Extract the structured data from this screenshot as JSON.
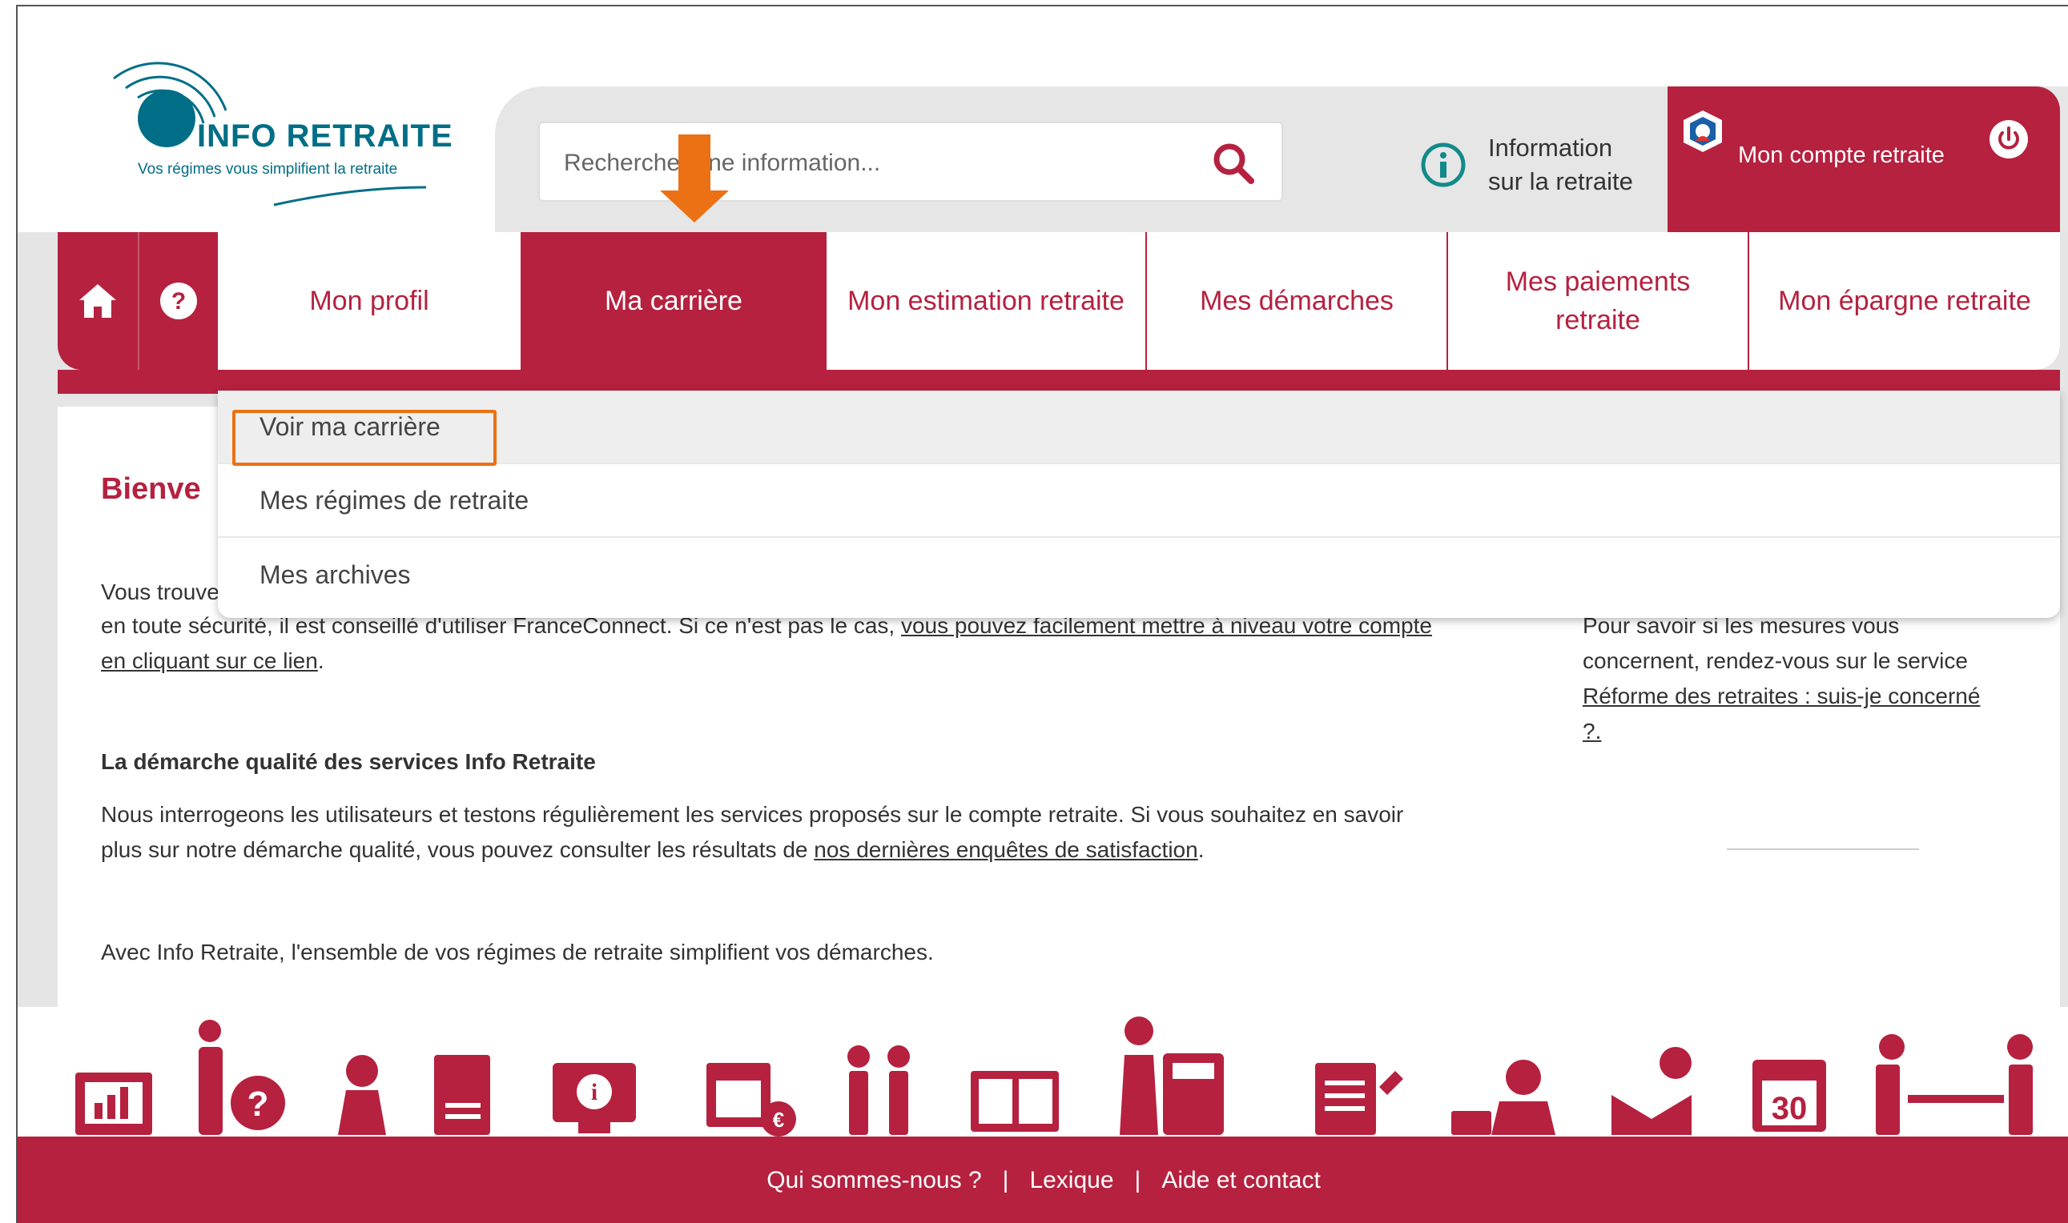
{
  "logo": {
    "title": "INFO RETRAITE",
    "subtitle": "Vos régimes vous simplifient la retraite"
  },
  "search": {
    "placeholder": "Rechercher une information..."
  },
  "info_link": {
    "line1": "Information",
    "line2": "sur la retraite"
  },
  "account": {
    "label": "Mon compte retraite"
  },
  "nav": {
    "tabs": [
      {
        "label": "Mon profil"
      },
      {
        "label": "Ma carrière",
        "active": true
      },
      {
        "label": "Mon estimation retraite"
      },
      {
        "label": "Mes démarches"
      },
      {
        "label": "Mes paiements retraite"
      },
      {
        "label": "Mon épargne retraite"
      }
    ]
  },
  "dropdown": {
    "items": [
      {
        "label": "Voir ma carrière"
      },
      {
        "label": "Mes régimes de retraite"
      },
      {
        "label": "Mes archives"
      }
    ]
  },
  "content": {
    "welcome": "Bienve",
    "p1_start": "Vous trouve",
    "p1_line2": "en toute sécurité, il est conseillé d'utiliser FranceConnect. Si ce n'est pas le cas, ",
    "p1_link_a": "vous pouvez facilement mettre à niveau votre compte",
    "p1_link_b": "en cliquant sur ce lien",
    "p1_end": ".",
    "quality_title": "La démarche qualité des services Info Retraite",
    "quality_line1": "Nous interrogeons les utilisateurs et testons régulièrement les services proposés sur le compte retraite. Si vous souhaitez en savoir",
    "quality_line2": "plus sur notre démarche qualité, vous pouvez consulter les résultats de ",
    "quality_link": "nos dernières enquêtes de satisfaction",
    "quality_end": ".",
    "closing": "Avec Info Retraite, l'ensemble de vos régimes de retraite simplifient vos démarches.",
    "side_line1": "Pour savoir si les mesures vous",
    "side_line2": "concernent, rendez-vous sur le service",
    "side_link1": "Réforme des retraites : suis-je concerné",
    "side_link2": "?."
  },
  "footer": {
    "links": [
      "Qui sommes-nous ?",
      "Lexique",
      "Aide et contact"
    ],
    "separator": "|"
  },
  "colors": {
    "brand": "#b5213f",
    "logo": "#006e86",
    "annotation": "#ec7014"
  },
  "icons": [
    "home-icon",
    "help-icon",
    "search-icon",
    "info-icon",
    "account-shield-icon",
    "power-icon"
  ]
}
